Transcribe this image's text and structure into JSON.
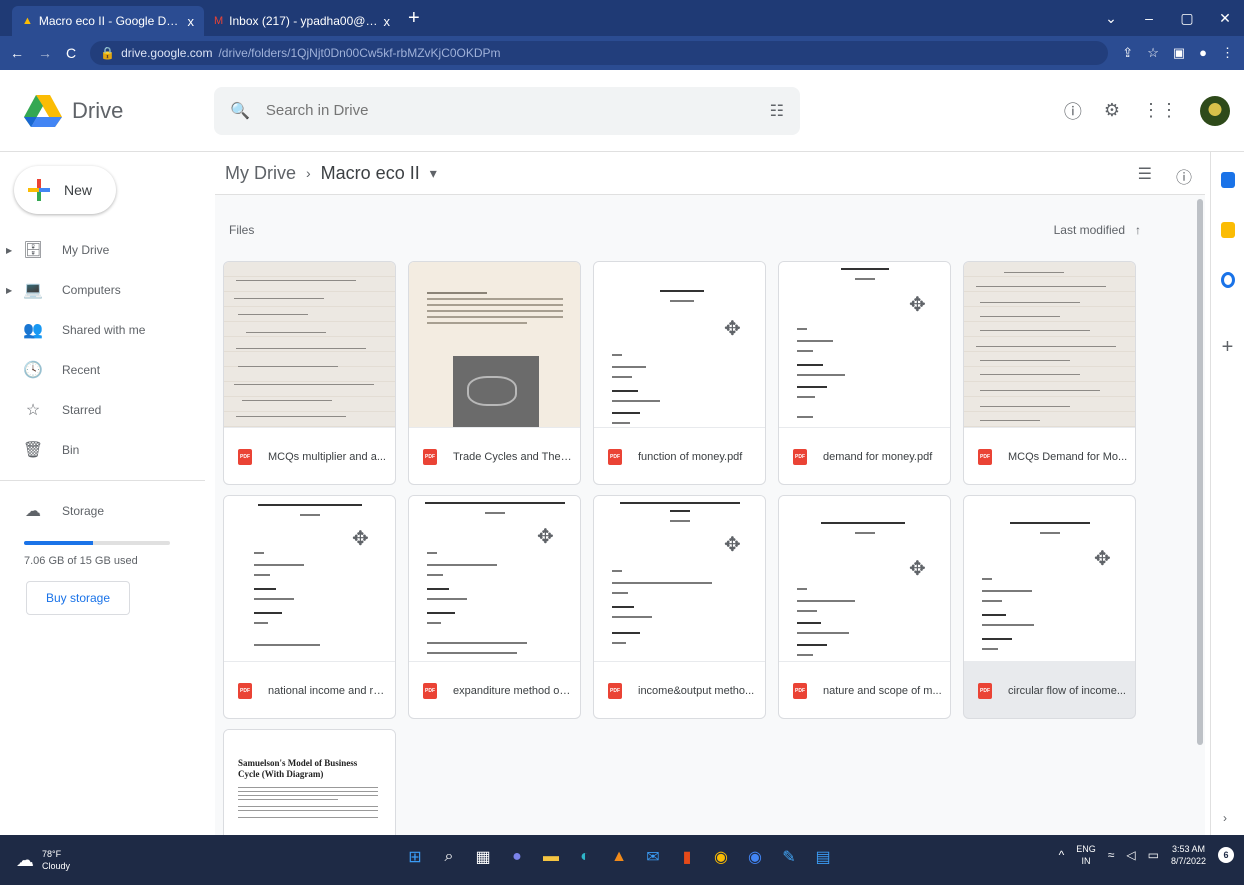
{
  "browser": {
    "tabs": [
      {
        "title": "Macro eco II - Google Drive",
        "close": "x",
        "active": true
      },
      {
        "title": "Inbox (217) - ypadha00@gmail.",
        "close": "x",
        "active": false
      }
    ],
    "new_tab": "+",
    "url_domain": "drive.google.com",
    "url_path": "/drive/folders/1QjNjt0Dn00Cw5kf-rbMZvKjC0OKDPm",
    "window_controls": [
      "⌄",
      "–",
      "▢",
      "✕"
    ]
  },
  "drive": {
    "app_name": "Drive",
    "search_placeholder": "Search in Drive",
    "icons": {
      "help": "help-icon",
      "settings": "settings-icon",
      "apps": "apps-grid-icon"
    }
  },
  "sidebar": {
    "new_label": "New",
    "items": [
      {
        "label": "My Drive",
        "icon": "my-drive-icon",
        "glyph": "🗄",
        "caret": true
      },
      {
        "label": "Computers",
        "icon": "computers-icon",
        "glyph": "💻",
        "caret": true
      },
      {
        "label": "Shared with me",
        "icon": "shared-icon",
        "glyph": "👥",
        "caret": false
      },
      {
        "label": "Recent",
        "icon": "clock-icon",
        "glyph": "🕓",
        "caret": false
      },
      {
        "label": "Starred",
        "icon": "star-icon",
        "glyph": "☆",
        "caret": false
      },
      {
        "label": "Bin",
        "icon": "trash-icon",
        "glyph": "🗑",
        "caret": false
      }
    ],
    "storage_label": "Storage",
    "storage_used_text": "7.06 GB of 15 GB used",
    "storage_fraction": 0.47,
    "buy_storage": "Buy storage"
  },
  "main": {
    "breadcrumb_root": "My Drive",
    "breadcrumb_sep": "›",
    "breadcrumb_current": "Macro eco II",
    "breadcrumb_caret": "▾",
    "files_label": "Files",
    "sort_label": "Last modified",
    "sort_arrow": "↑",
    "files": [
      {
        "name": "MCQs multiplier and a...",
        "kind": "handwritten"
      },
      {
        "name": "Trade Cycles and Theo...",
        "kind": "photo"
      },
      {
        "name": "function of money.pdf",
        "kind": "doc"
      },
      {
        "name": "demand for money.pdf",
        "kind": "doc"
      },
      {
        "name": "MCQs Demand for Mo...",
        "kind": "handwritten"
      },
      {
        "name": "national income and re...",
        "kind": "doc"
      },
      {
        "name": "expanditure method of ...",
        "kind": "doc"
      },
      {
        "name": "income&output metho...",
        "kind": "doc"
      },
      {
        "name": "nature and scope of m...",
        "kind": "doc"
      },
      {
        "name": "circular flow of income...",
        "kind": "doc",
        "selected": true
      },
      {
        "name": "Samuelson's Model of Business Cycle (With Diagram)",
        "kind": "article"
      }
    ],
    "article_title": "Samuelson's Model of Business Cycle (With Diagram)",
    "pdf_badge": "PDF"
  },
  "taskbar": {
    "weather_temp": "78°F",
    "weather_desc": "Cloudy",
    "lang1": "ENG",
    "lang2": "IN",
    "time": "3:53 AM",
    "date": "8/7/2022",
    "notif_count": "6"
  },
  "colors": {
    "tabbar": "#1f3a75",
    "toolbar": "#2b4c92",
    "accent": "#1a73e8",
    "pdf": "#ea4335"
  }
}
